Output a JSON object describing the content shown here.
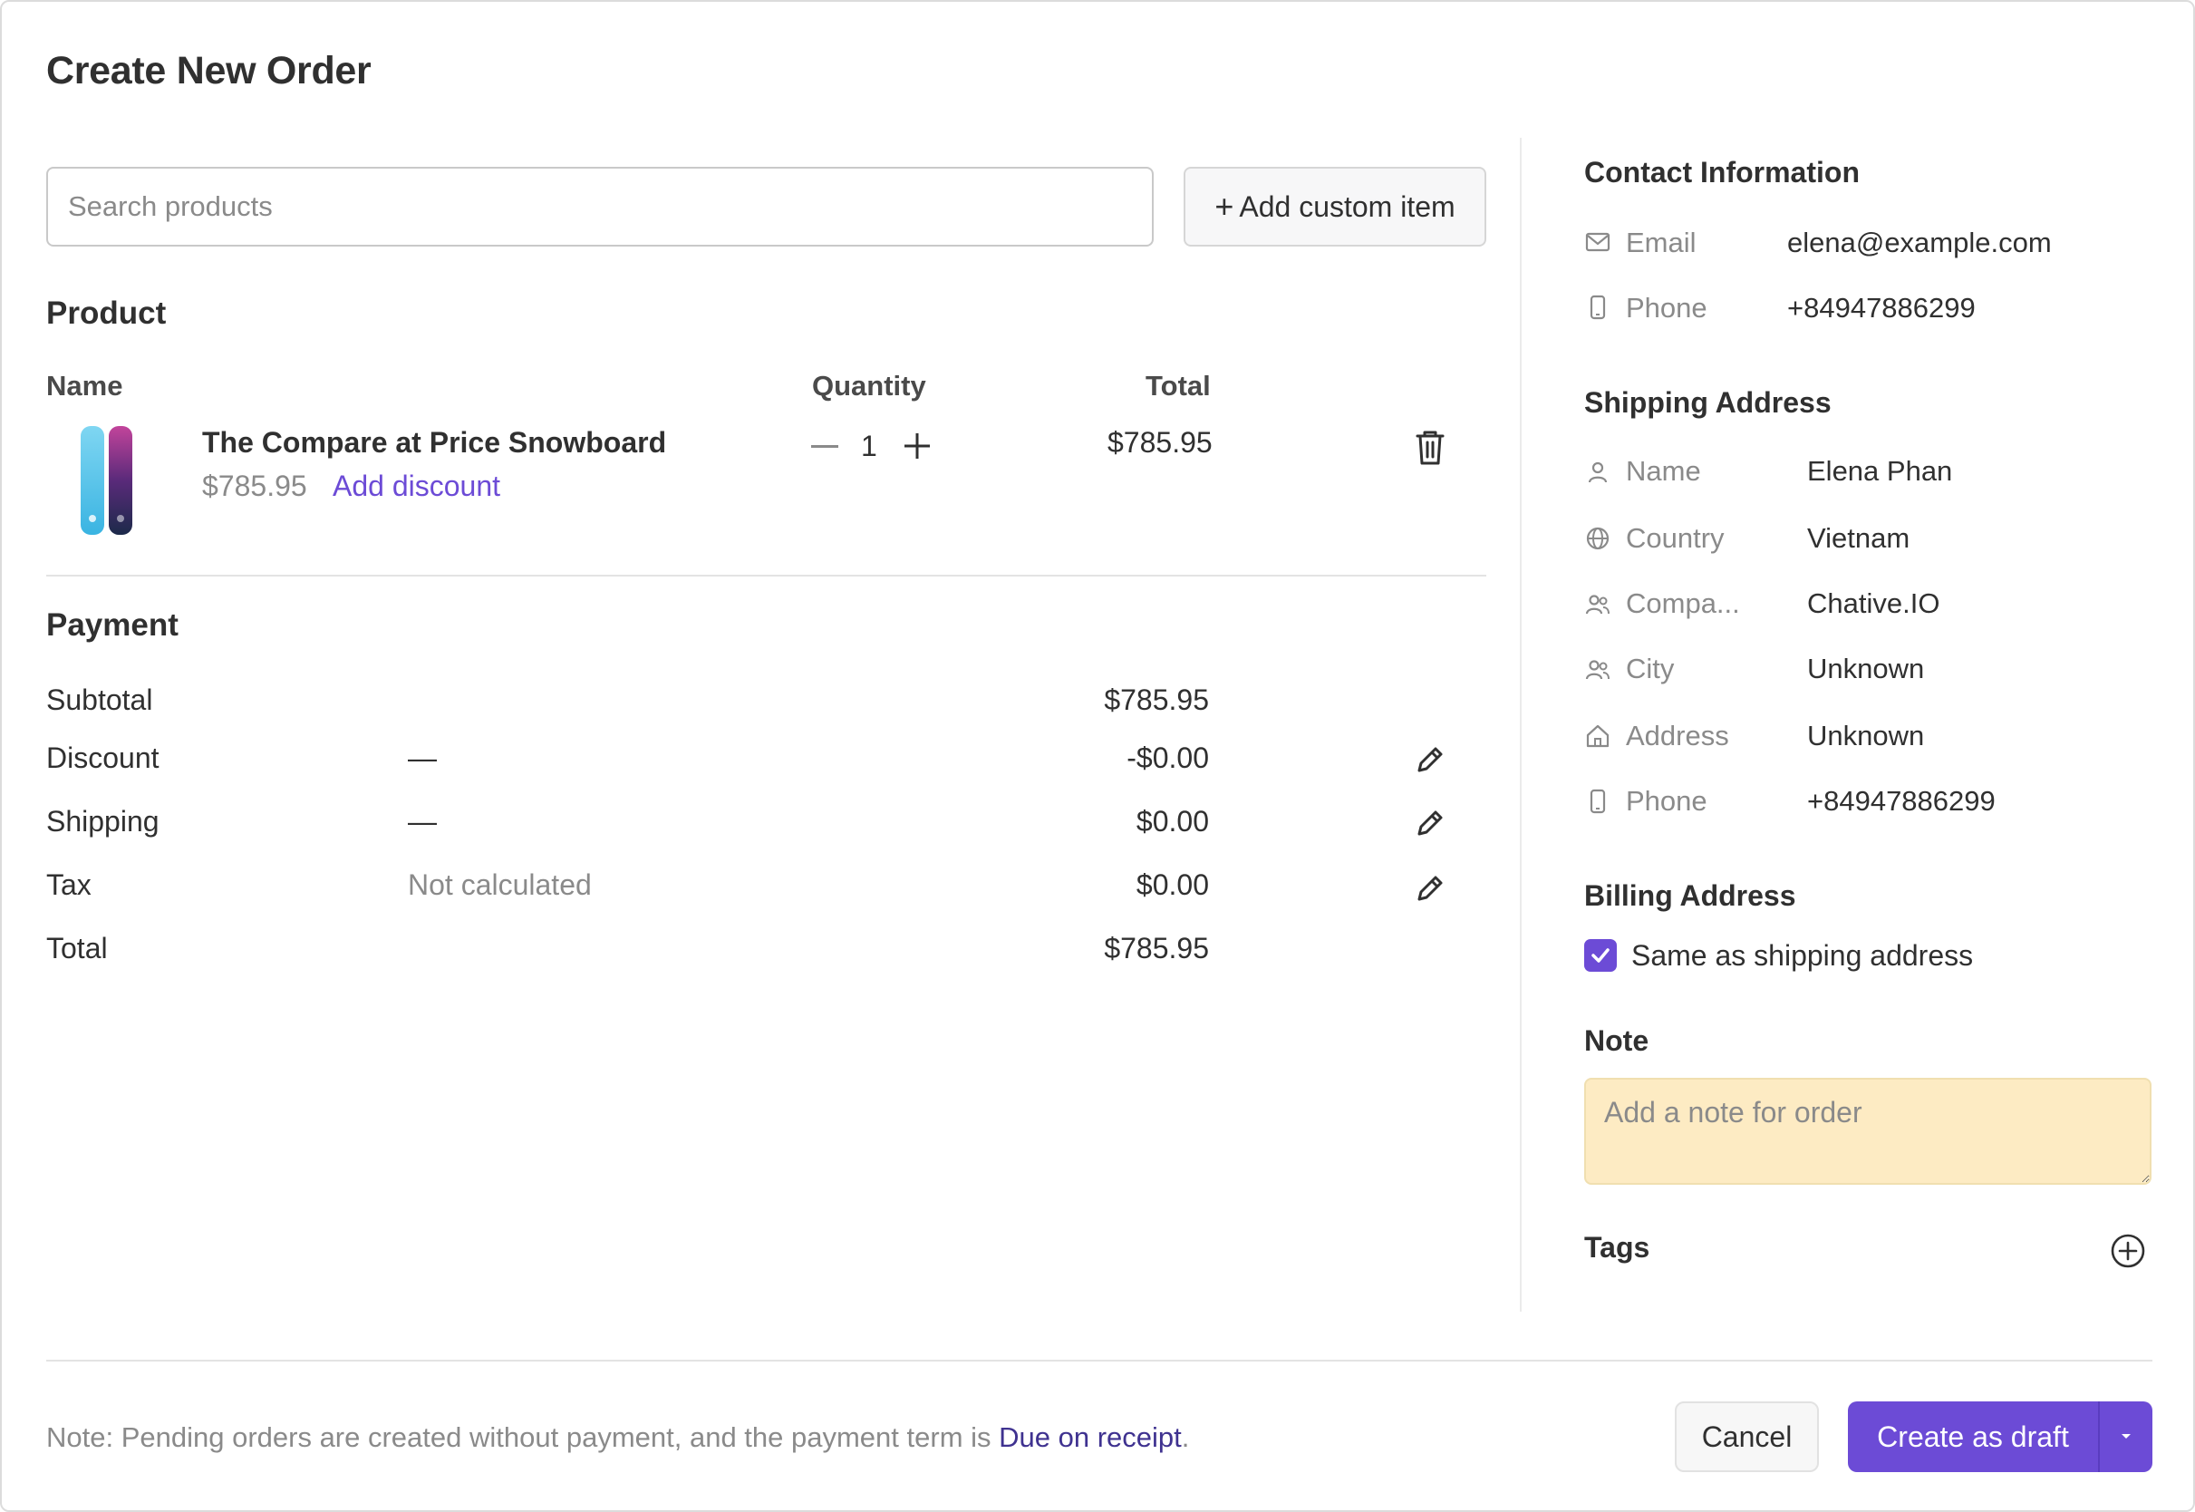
{
  "dialog": {
    "title": "Create New Order"
  },
  "search": {
    "placeholder": "Search products",
    "value": ""
  },
  "add_custom_item": {
    "icon": "plus-icon",
    "label": "Add custom item"
  },
  "product_section": {
    "title": "Product",
    "columns": {
      "name": "Name",
      "quantity": "Quantity",
      "total": "Total"
    },
    "items": [
      {
        "name": "The Compare at Price Snowboard",
        "price": "$785.95",
        "add_discount": "Add discount",
        "quantity": "1",
        "total": "$785.95",
        "thumbnail": "snowboard-thumbnail"
      }
    ]
  },
  "payment_section": {
    "title": "Payment",
    "rows": {
      "subtotal": {
        "label": "Subtotal",
        "value": "$785.95"
      },
      "discount": {
        "label": "Discount",
        "detail": "—",
        "value": "-$0.00"
      },
      "shipping": {
        "label": "Shipping",
        "detail": "—",
        "value": "$0.00"
      },
      "tax": {
        "label": "Tax",
        "detail": "Not calculated",
        "value": "$0.00"
      },
      "total": {
        "label": "Total",
        "value": "$785.95"
      }
    }
  },
  "contact": {
    "title": "Contact Information",
    "email": {
      "icon": "mail-icon",
      "label": "Email",
      "value": "elena@example.com"
    },
    "phone": {
      "icon": "phone-icon",
      "label": "Phone",
      "value": "+84947886299"
    }
  },
  "shipping_address": {
    "title": "Shipping Address",
    "name": {
      "icon": "person-icon",
      "label": "Name",
      "value": "Elena Phan"
    },
    "country": {
      "icon": "globe-icon",
      "label": "Country",
      "value": "Vietnam"
    },
    "company": {
      "icon": "people-icon",
      "label": "Compa...",
      "value": "Chative.IO"
    },
    "city": {
      "icon": "people-icon",
      "label": "City",
      "value": "Unknown"
    },
    "address": {
      "icon": "home-icon",
      "label": "Address",
      "value": "Unknown"
    },
    "phone": {
      "icon": "phone-icon",
      "label": "Phone",
      "value": "+84947886299"
    }
  },
  "billing_address": {
    "title": "Billing Address",
    "same_as_shipping": {
      "label": "Same as shipping address",
      "checked": true
    }
  },
  "note": {
    "title": "Note",
    "placeholder": "Add a note for order"
  },
  "tags": {
    "title": "Tags"
  },
  "footer": {
    "note_prefix": "Note: Pending orders are created without payment, and the payment term is ",
    "note_link": "Due on receipt",
    "note_suffix": ".",
    "cancel": "Cancel",
    "create_draft": "Create as draft"
  },
  "colors": {
    "accent": "#6c4bd6",
    "link_dark": "#3f3290",
    "note_bg": "#fdebc3",
    "text": "#303030",
    "muted": "#8a8a8a"
  }
}
